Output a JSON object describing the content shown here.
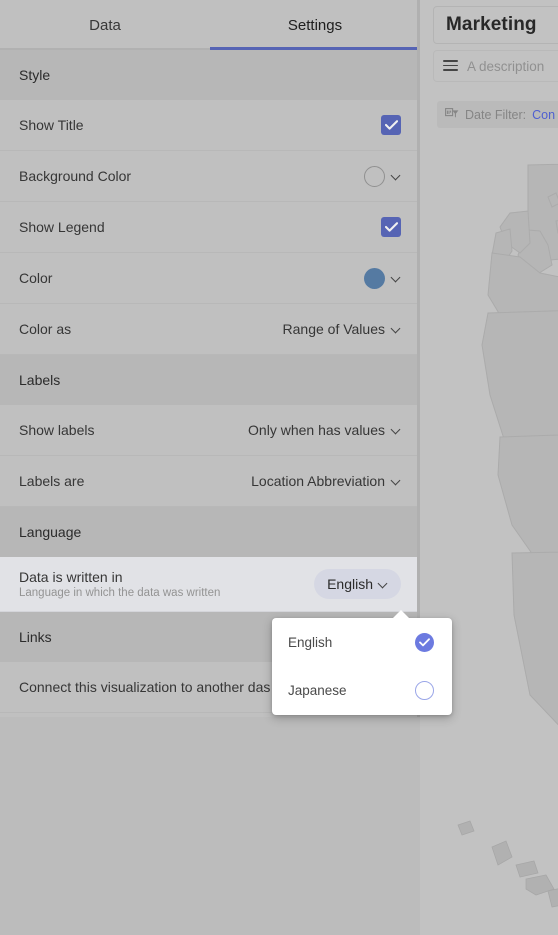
{
  "panel": {
    "tabs": [
      {
        "label": "Data",
        "active": false
      },
      {
        "label": "Settings",
        "active": true
      }
    ],
    "sections": [
      {
        "header": "Style",
        "rows": [
          {
            "label": "Show Title",
            "control": "checkbox",
            "checked": true
          },
          {
            "label": "Background Color",
            "control": "swatch-ring",
            "value": ""
          },
          {
            "label": "Show Legend",
            "control": "checkbox",
            "checked": true
          },
          {
            "label": "Color",
            "control": "swatch-fill",
            "value": "",
            "color": "#5b82ad"
          },
          {
            "label": "Color as",
            "control": "select",
            "value": "Range of Values"
          }
        ]
      },
      {
        "header": "Labels",
        "rows": [
          {
            "label": "Show labels",
            "control": "select",
            "value": "Only when has values"
          },
          {
            "label": "Labels are",
            "control": "select",
            "value": "Location Abbreviation"
          }
        ]
      },
      {
        "header": "Language",
        "rows": [
          {
            "label": "Data is written in",
            "sublabel": "Language in which the data was written",
            "control": "pill",
            "value": "English",
            "highlighted": true
          }
        ]
      },
      {
        "header": "Links",
        "rows": [
          {
            "label": "Connect this visualization to another das",
            "control": "none"
          }
        ]
      }
    ]
  },
  "language_popover": {
    "options": [
      {
        "label": "English",
        "selected": true
      },
      {
        "label": "Japanese",
        "selected": false
      }
    ]
  },
  "dashboard": {
    "title": "Marketing",
    "description_placeholder": "A description",
    "date_filter_label": "Date Filter:",
    "date_filter_value": "Con",
    "icons": {
      "description": "list-icon",
      "filter": "filter-icon"
    }
  },
  "colors": {
    "accent": "#5c6bc0",
    "radio_accent": "#6c7ae0",
    "color_swatch": "#5b82ad",
    "link": "#5566dd",
    "panel_bg": "#cccccc",
    "section_bg": "#c3c3c3",
    "highlight_row_bg": "#f0f1f5"
  }
}
